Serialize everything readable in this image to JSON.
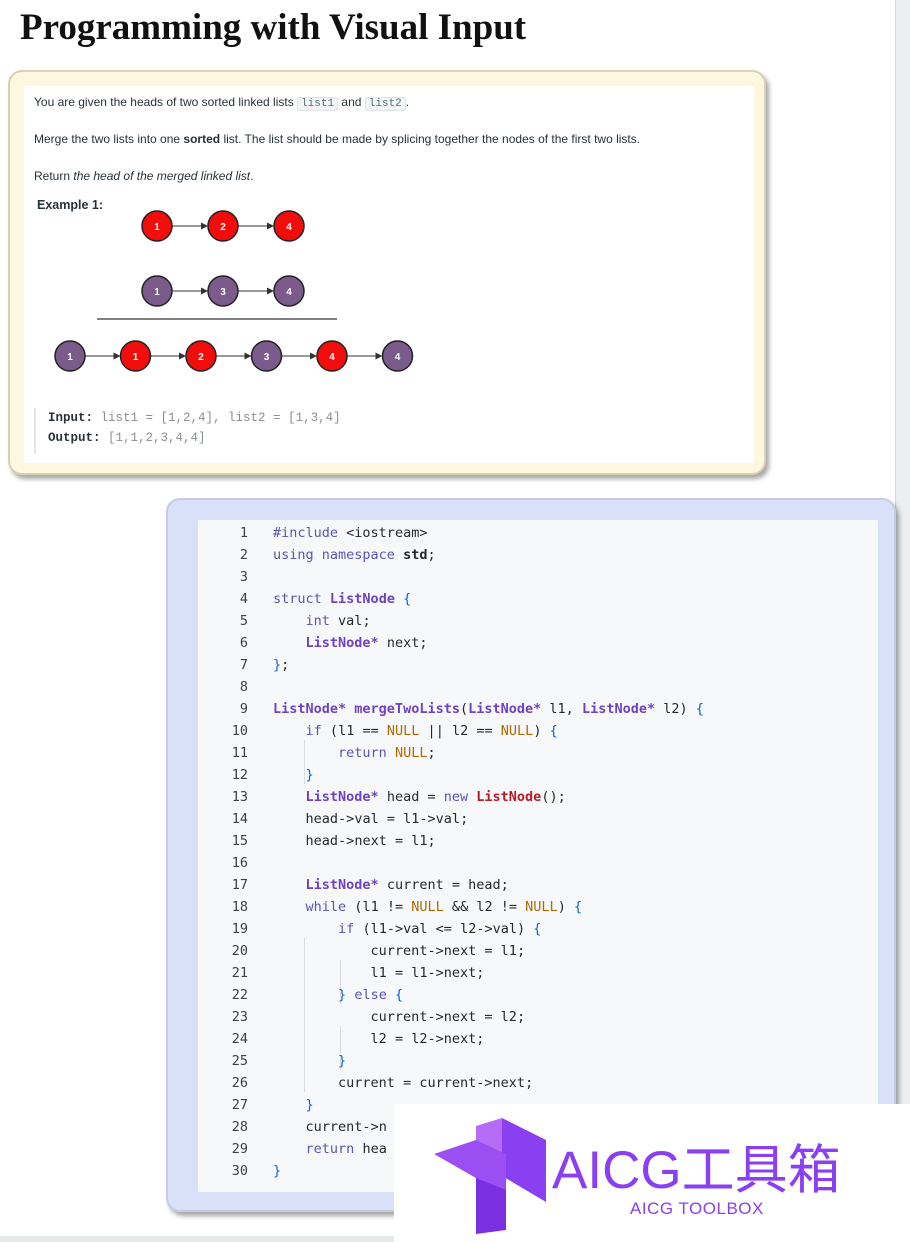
{
  "page": {
    "title": "Programming with Visual Input"
  },
  "problem": {
    "p1_before": "You are given the heads of two sorted linked lists ",
    "p1_code1": "list1",
    "p1_and": " and ",
    "p1_code2": "list2",
    "p1_end": ".",
    "p2_before": "Merge the two lists into one ",
    "p2_bold": "sorted",
    "p2_after": " list. The list should be made by splicing together the nodes of the first two lists.",
    "p3_before": "Return ",
    "p3_italic": "the head of the merged linked list",
    "p3_end": ".",
    "example_title": "Example 1:",
    "list1": [
      "1",
      "2",
      "4"
    ],
    "list2": [
      "1",
      "3",
      "4"
    ],
    "merged": [
      "1",
      "1",
      "2",
      "3",
      "4",
      "4"
    ],
    "input_label": "Input:",
    "input_value": "list1 = [1,2,4], list2 = [1,3,4]",
    "output_label": "Output:",
    "output_value": "[1,1,2,3,4,4]",
    "colors": {
      "red_node": "#f20d0d",
      "purple_node": "#7b5a8c"
    }
  },
  "code": {
    "lines": [
      "#include <iostream>",
      "using namespace std;",
      "",
      "struct ListNode {",
      "    int val;",
      "    ListNode* next;",
      "};",
      "",
      "ListNode* mergeTwoLists(ListNode* l1, ListNode* l2) {",
      "    if (l1 == NULL || l2 == NULL) {",
      "        return NULL;",
      "    }",
      "    ListNode* head = new ListNode();",
      "    head->val = l1->val;",
      "    head->next = l1;",
      "",
      "    ListNode* current = head;",
      "    while (l1 != NULL && l2 != NULL) {",
      "        if (l1->val <= l2->val) {",
      "            current->next = l1;",
      "            l1 = l1->next;",
      "        } else {",
      "            current->next = l2;",
      "            l2 = l2->next;",
      "        }",
      "        current = current->next;",
      "    }",
      "    current->n",
      "    return hea",
      "}"
    ]
  },
  "watermark": {
    "main": "AICG工具箱",
    "sub": "AICG TOOLBOX",
    "color": "#8a3ff0"
  }
}
